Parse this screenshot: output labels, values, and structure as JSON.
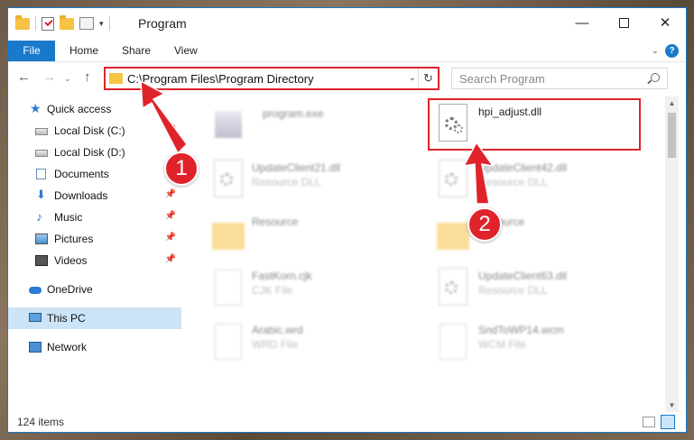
{
  "window": {
    "title": "Program",
    "controls": {
      "minimize": "—",
      "maximize": "",
      "close": "✕"
    }
  },
  "ribbon": {
    "tabs": [
      "File",
      "Home",
      "Share",
      "View"
    ],
    "expand": "⌄",
    "help": "?"
  },
  "nav": {
    "back": "←",
    "forward": "→",
    "history": "⌄",
    "up": "↑",
    "address": "C:\\Program Files\\Program Directory",
    "dropdown": "⌄",
    "refresh": "↻",
    "search_placeholder": "Search Program"
  },
  "sidebar": {
    "items": [
      {
        "label": "Quick access",
        "icon": "star-icon",
        "pinned": false
      },
      {
        "label": "Local Disk (C:)",
        "icon": "drive-icon",
        "pinned": true
      },
      {
        "label": "Local Disk (D:)",
        "icon": "drive-icon",
        "pinned": false
      },
      {
        "label": "Documents",
        "icon": "documents-icon",
        "pinned": true
      },
      {
        "label": "Downloads",
        "icon": "download-icon",
        "pinned": true
      },
      {
        "label": "Music",
        "icon": "music-icon",
        "pinned": true
      },
      {
        "label": "Pictures",
        "icon": "pictures-icon",
        "pinned": true
      },
      {
        "label": "Videos",
        "icon": "videos-icon",
        "pinned": true
      },
      {
        "label": "OneDrive",
        "icon": "onedrive-icon",
        "pinned": false
      },
      {
        "label": "This PC",
        "icon": "pc-icon",
        "pinned": false,
        "selected": true
      },
      {
        "label": "Network",
        "icon": "network-icon",
        "pinned": false
      }
    ],
    "pin_glyph": "📌"
  },
  "files": [
    {
      "name": "program.exe",
      "type": "",
      "icon": "exe-icon"
    },
    {
      "name": "hpi_adjust.dll",
      "type": "",
      "icon": "dll-gear-icon"
    },
    {
      "name": "UpdateClient21.dll",
      "type": "Resource DLL",
      "icon": "dll-gear-icon"
    },
    {
      "name": "UpdateClient42.dll",
      "type": "Resource DLL",
      "icon": "dll-gear-icon"
    },
    {
      "name": "Resource",
      "type": "",
      "icon": "folder-icon"
    },
    {
      "name": "Resource",
      "type": "",
      "icon": "folder-icon"
    },
    {
      "name": "FastKorn.cjk",
      "type": "CJK File",
      "icon": "file-icon"
    },
    {
      "name": "UpdateClient63.dll",
      "type": "Resource DLL",
      "icon": "dll-gear-icon"
    },
    {
      "name": "Arabic.wrd",
      "type": "WRD File",
      "icon": "file-icon"
    },
    {
      "name": "SndToWP14.wcm",
      "type": "WCM File",
      "icon": "file-icon"
    }
  ],
  "status": {
    "items_count": "124 items"
  },
  "annotations": {
    "step1": "1",
    "step2": "2",
    "color": "#e0232b"
  },
  "colors": {
    "accent": "#1979ca",
    "selection": "#cce4f7",
    "highlight": "#e0232b"
  }
}
